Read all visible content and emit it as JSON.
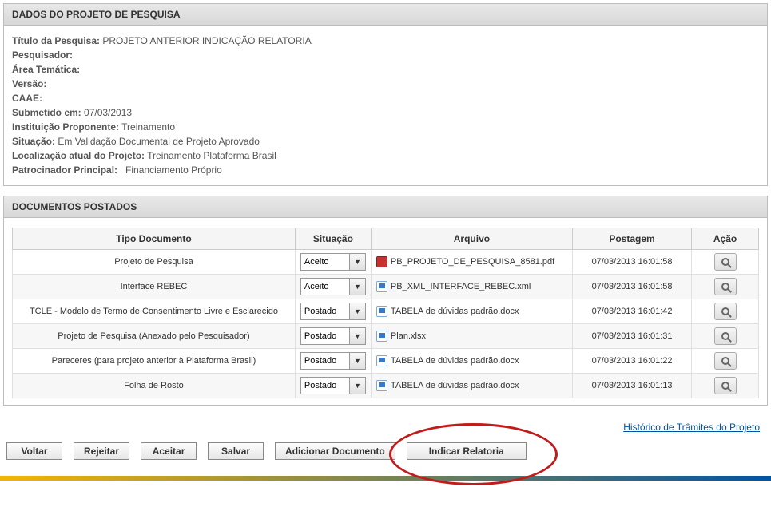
{
  "panel1": {
    "title": "DADOS DO PROJETO DE PESQUISA",
    "fields": {
      "titulo_label": "Título da Pesquisa:",
      "titulo_value": "PROJETO ANTERIOR INDICAÇÃO RELATORIA",
      "pesquisador_label": "Pesquisador:",
      "pesquisador_value": "",
      "area_label": "Área Temática:",
      "area_value": "",
      "versao_label": "Versão:",
      "versao_value": "",
      "caae_label": "CAAE:",
      "caae_value": "",
      "submetido_label": "Submetido em:",
      "submetido_value": "07/03/2013",
      "instituicao_label": "Instituição Proponente:",
      "instituicao_value": "Treinamento",
      "situacao_label": "Situação:",
      "situacao_value": "Em Validação Documental de Projeto Aprovado",
      "localizacao_label": "Localização atual do Projeto:",
      "localizacao_value": "Treinamento Plataforma Brasil",
      "patrocinador_label": "Patrocinador Principal:",
      "patrocinador_value": "Financiamento Próprio"
    }
  },
  "panel2": {
    "title": "DOCUMENTOS POSTADOS",
    "headers": {
      "tipo": "Tipo Documento",
      "situacao": "Situação",
      "arquivo": "Arquivo",
      "postagem": "Postagem",
      "acao": "Ação"
    },
    "rows": [
      {
        "tipo": "Projeto de Pesquisa",
        "situacao": "Aceito",
        "arquivo": "PB_PROJETO_DE_PESQUISA_8581.pdf",
        "ftype": "pdf",
        "postagem": "07/03/2013 16:01:58"
      },
      {
        "tipo": "Interface REBEC",
        "situacao": "Aceito",
        "arquivo": "PB_XML_INTERFACE_REBEC.xml",
        "ftype": "xml",
        "postagem": "07/03/2013 16:01:58"
      },
      {
        "tipo": "TCLE - Modelo de Termo de Consentimento Livre e Esclarecido",
        "situacao": "Postado",
        "arquivo": "TABELA de dúvidas padrão.docx",
        "ftype": "docx",
        "postagem": "07/03/2013 16:01:42"
      },
      {
        "tipo": "Projeto de Pesquisa (Anexado pelo Pesquisador)",
        "situacao": "Postado",
        "arquivo": "Plan.xlsx",
        "ftype": "xlsx",
        "postagem": "07/03/2013 16:01:31"
      },
      {
        "tipo": "Pareceres (para projeto anterior à Plataforma Brasil)",
        "situacao": "Postado",
        "arquivo": "TABELA de dúvidas padrão.docx",
        "ftype": "docx",
        "postagem": "07/03/2013 16:01:22"
      },
      {
        "tipo": "Folha de Rosto",
        "situacao": "Postado",
        "arquivo": "TABELA de dúvidas padrão.docx",
        "ftype": "docx",
        "postagem": "07/03/2013 16:01:13"
      }
    ]
  },
  "history_link": "Histórico de Trâmites do Projeto",
  "buttons": {
    "voltar": "Voltar",
    "rejeitar": "Rejeitar",
    "aceitar": "Aceitar",
    "salvar": "Salvar",
    "adicionar": "Adicionar Documento",
    "indicar": "Indicar Relatoria"
  }
}
